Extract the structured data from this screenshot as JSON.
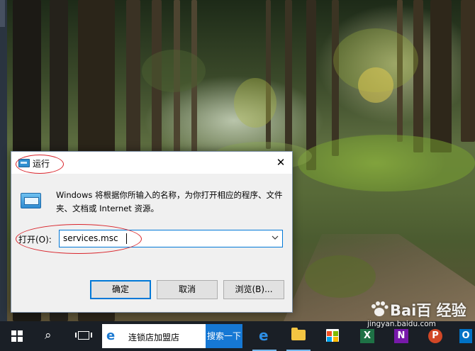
{
  "dialog": {
    "title": "运行",
    "close_glyph": "✕",
    "description": "Windows 将根据你所输入的名称，为你打开相应的程序、文件夹、文档或 Internet 资源。",
    "open_label": "打开(O):",
    "open_value": "services.msc",
    "buttons": {
      "ok": "确定",
      "cancel": "取消",
      "browse": "浏览(B)..."
    },
    "icon": "run-icon"
  },
  "taskbar": {
    "start_icon": "windows-logo-icon",
    "search_glyph": "⌕",
    "searchbox_icon": "e",
    "searchbox_text": "连锁店加盟店",
    "search_button": "搜索一下",
    "edge_glyph": "e",
    "apps": [
      "excel-icon",
      "onenote-icon",
      "powerpoint-icon",
      "outlook-icon"
    ],
    "app_letters": [
      "X",
      "N",
      "P",
      "O"
    ]
  },
  "watermark": {
    "brand": "Bai百 经验",
    "url": "jingyan.baidu.com"
  },
  "colors": {
    "accent": "#0078d7",
    "annotation": "#d9242b",
    "taskbar": "#1a1f26"
  }
}
